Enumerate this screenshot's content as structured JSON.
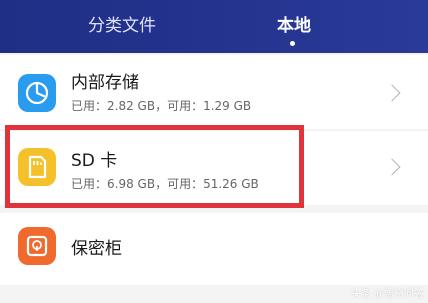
{
  "header": {
    "tabs": [
      {
        "label": "分类文件",
        "active": false
      },
      {
        "label": "本地",
        "active": true
      }
    ]
  },
  "storage": {
    "items": [
      {
        "title": "内部存储",
        "subtitle": "已用：2.82 GB，可用：1.29 GB",
        "icon": "pie-chart-icon"
      },
      {
        "title": "SD 卡",
        "subtitle": "已用：6.98 GB，可用：51.26 GB",
        "icon": "sd-card-icon"
      },
      {
        "title": "保密柜",
        "icon": "safe-icon"
      }
    ]
  },
  "watermark": {
    "text": "头条 @悟空问答"
  },
  "colors": {
    "header": "#24348f",
    "highlight": "#e0333b",
    "internal_icon": "#2a9cf0",
    "sd_icon": "#f5c12b",
    "safe_icon": "#ef6a2c"
  }
}
